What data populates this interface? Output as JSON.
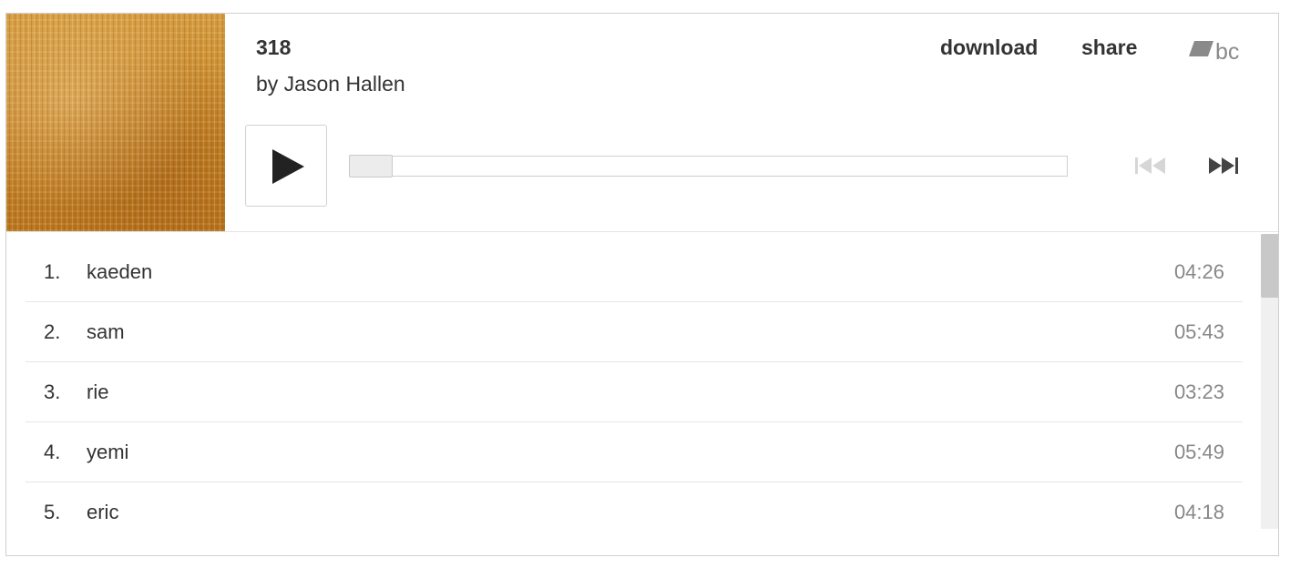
{
  "album": {
    "title": "318",
    "artist_line": "by Jason Hallen",
    "art_colors": [
      "#c98a2b",
      "#d49a3c",
      "#b9741b"
    ]
  },
  "header": {
    "download_label": "download",
    "share_label": "share",
    "logo_text": "bc",
    "logo_name": "bandcamp-logo"
  },
  "controls": {
    "play_icon": "play-icon",
    "prev_icon": "previous-track-icon",
    "next_icon": "next-track-icon",
    "progress": 0.0,
    "prev_enabled": false,
    "next_enabled": true
  },
  "tracks": [
    {
      "num": "1.",
      "name": "kaeden",
      "time": "04:26"
    },
    {
      "num": "2.",
      "name": "sam",
      "time": "05:43"
    },
    {
      "num": "3.",
      "name": "rie",
      "time": "03:23"
    },
    {
      "num": "4.",
      "name": "yemi",
      "time": "05:49"
    },
    {
      "num": "5.",
      "name": "eric",
      "time": "04:18"
    }
  ],
  "colors": {
    "text": "#333333",
    "muted": "#888888",
    "border": "#cfcfcf",
    "disabled_icon": "#d6d6d6",
    "logo": "#8a8a8a"
  }
}
